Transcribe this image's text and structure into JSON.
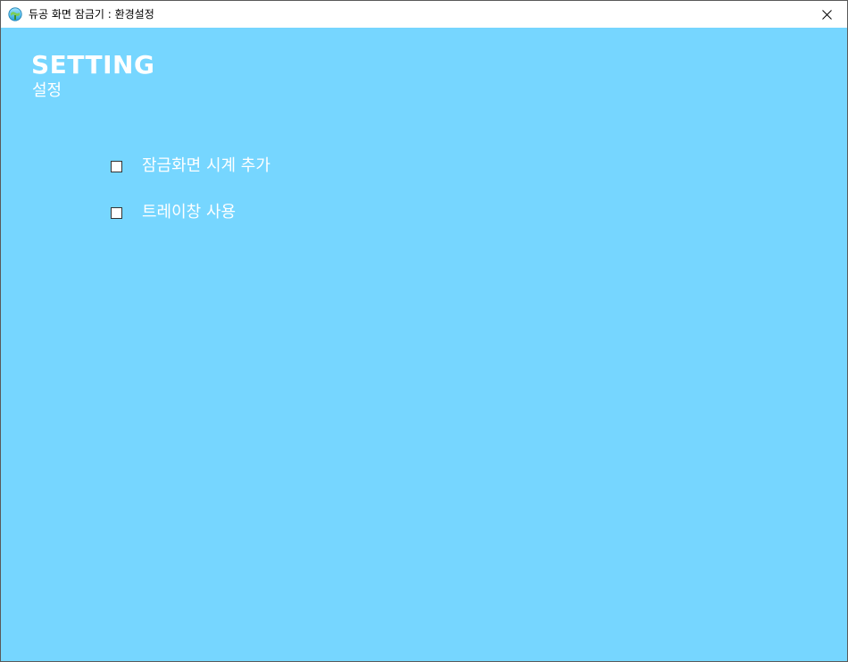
{
  "window": {
    "title": "듀공 화면 잠금기 : 환경설정",
    "app_icon": "globe-app-icon",
    "close_icon": "close-icon",
    "background_color": "#76d6ff"
  },
  "header": {
    "title_en": "SETTING",
    "title_ko": "설정"
  },
  "options": [
    {
      "label": "잠금화면 시계 추가",
      "checked": false
    },
    {
      "label": "트레이창 사용",
      "checked": false
    }
  ]
}
